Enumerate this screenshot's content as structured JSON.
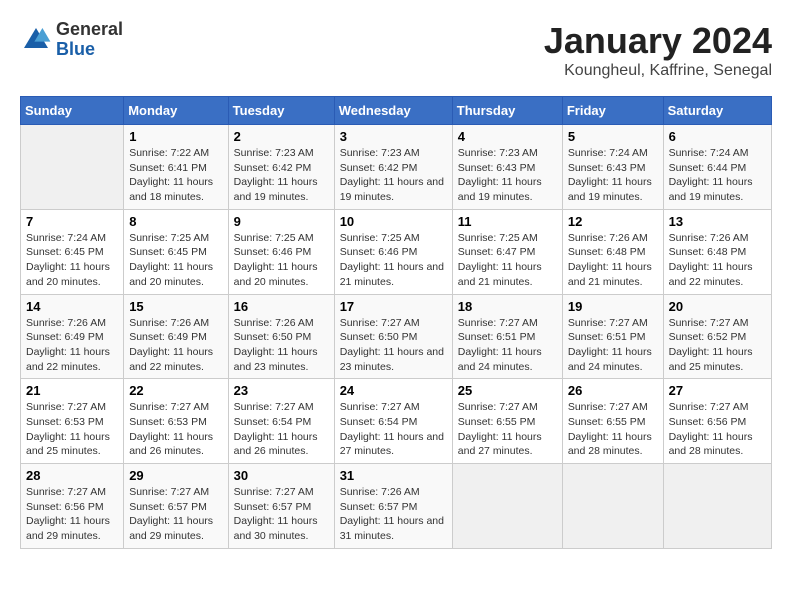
{
  "logo": {
    "general": "General",
    "blue": "Blue"
  },
  "title": "January 2024",
  "subtitle": "Koungheul, Kaffrine, Senegal",
  "days_header": [
    "Sunday",
    "Monday",
    "Tuesday",
    "Wednesday",
    "Thursday",
    "Friday",
    "Saturday"
  ],
  "weeks": [
    [
      {
        "num": "",
        "empty": true
      },
      {
        "num": "1",
        "sunrise": "Sunrise: 7:22 AM",
        "sunset": "Sunset: 6:41 PM",
        "daylight": "Daylight: 11 hours and 18 minutes."
      },
      {
        "num": "2",
        "sunrise": "Sunrise: 7:23 AM",
        "sunset": "Sunset: 6:42 PM",
        "daylight": "Daylight: 11 hours and 19 minutes."
      },
      {
        "num": "3",
        "sunrise": "Sunrise: 7:23 AM",
        "sunset": "Sunset: 6:42 PM",
        "daylight": "Daylight: 11 hours and 19 minutes."
      },
      {
        "num": "4",
        "sunrise": "Sunrise: 7:23 AM",
        "sunset": "Sunset: 6:43 PM",
        "daylight": "Daylight: 11 hours and 19 minutes."
      },
      {
        "num": "5",
        "sunrise": "Sunrise: 7:24 AM",
        "sunset": "Sunset: 6:43 PM",
        "daylight": "Daylight: 11 hours and 19 minutes."
      },
      {
        "num": "6",
        "sunrise": "Sunrise: 7:24 AM",
        "sunset": "Sunset: 6:44 PM",
        "daylight": "Daylight: 11 hours and 19 minutes."
      }
    ],
    [
      {
        "num": "7",
        "sunrise": "Sunrise: 7:24 AM",
        "sunset": "Sunset: 6:45 PM",
        "daylight": "Daylight: 11 hours and 20 minutes."
      },
      {
        "num": "8",
        "sunrise": "Sunrise: 7:25 AM",
        "sunset": "Sunset: 6:45 PM",
        "daylight": "Daylight: 11 hours and 20 minutes."
      },
      {
        "num": "9",
        "sunrise": "Sunrise: 7:25 AM",
        "sunset": "Sunset: 6:46 PM",
        "daylight": "Daylight: 11 hours and 20 minutes."
      },
      {
        "num": "10",
        "sunrise": "Sunrise: 7:25 AM",
        "sunset": "Sunset: 6:46 PM",
        "daylight": "Daylight: 11 hours and 21 minutes."
      },
      {
        "num": "11",
        "sunrise": "Sunrise: 7:25 AM",
        "sunset": "Sunset: 6:47 PM",
        "daylight": "Daylight: 11 hours and 21 minutes."
      },
      {
        "num": "12",
        "sunrise": "Sunrise: 7:26 AM",
        "sunset": "Sunset: 6:48 PM",
        "daylight": "Daylight: 11 hours and 21 minutes."
      },
      {
        "num": "13",
        "sunrise": "Sunrise: 7:26 AM",
        "sunset": "Sunset: 6:48 PM",
        "daylight": "Daylight: 11 hours and 22 minutes."
      }
    ],
    [
      {
        "num": "14",
        "sunrise": "Sunrise: 7:26 AM",
        "sunset": "Sunset: 6:49 PM",
        "daylight": "Daylight: 11 hours and 22 minutes."
      },
      {
        "num": "15",
        "sunrise": "Sunrise: 7:26 AM",
        "sunset": "Sunset: 6:49 PM",
        "daylight": "Daylight: 11 hours and 22 minutes."
      },
      {
        "num": "16",
        "sunrise": "Sunrise: 7:26 AM",
        "sunset": "Sunset: 6:50 PM",
        "daylight": "Daylight: 11 hours and 23 minutes."
      },
      {
        "num": "17",
        "sunrise": "Sunrise: 7:27 AM",
        "sunset": "Sunset: 6:50 PM",
        "daylight": "Daylight: 11 hours and 23 minutes."
      },
      {
        "num": "18",
        "sunrise": "Sunrise: 7:27 AM",
        "sunset": "Sunset: 6:51 PM",
        "daylight": "Daylight: 11 hours and 24 minutes."
      },
      {
        "num": "19",
        "sunrise": "Sunrise: 7:27 AM",
        "sunset": "Sunset: 6:51 PM",
        "daylight": "Daylight: 11 hours and 24 minutes."
      },
      {
        "num": "20",
        "sunrise": "Sunrise: 7:27 AM",
        "sunset": "Sunset: 6:52 PM",
        "daylight": "Daylight: 11 hours and 25 minutes."
      }
    ],
    [
      {
        "num": "21",
        "sunrise": "Sunrise: 7:27 AM",
        "sunset": "Sunset: 6:53 PM",
        "daylight": "Daylight: 11 hours and 25 minutes."
      },
      {
        "num": "22",
        "sunrise": "Sunrise: 7:27 AM",
        "sunset": "Sunset: 6:53 PM",
        "daylight": "Daylight: 11 hours and 26 minutes."
      },
      {
        "num": "23",
        "sunrise": "Sunrise: 7:27 AM",
        "sunset": "Sunset: 6:54 PM",
        "daylight": "Daylight: 11 hours and 26 minutes."
      },
      {
        "num": "24",
        "sunrise": "Sunrise: 7:27 AM",
        "sunset": "Sunset: 6:54 PM",
        "daylight": "Daylight: 11 hours and 27 minutes."
      },
      {
        "num": "25",
        "sunrise": "Sunrise: 7:27 AM",
        "sunset": "Sunset: 6:55 PM",
        "daylight": "Daylight: 11 hours and 27 minutes."
      },
      {
        "num": "26",
        "sunrise": "Sunrise: 7:27 AM",
        "sunset": "Sunset: 6:55 PM",
        "daylight": "Daylight: 11 hours and 28 minutes."
      },
      {
        "num": "27",
        "sunrise": "Sunrise: 7:27 AM",
        "sunset": "Sunset: 6:56 PM",
        "daylight": "Daylight: 11 hours and 28 minutes."
      }
    ],
    [
      {
        "num": "28",
        "sunrise": "Sunrise: 7:27 AM",
        "sunset": "Sunset: 6:56 PM",
        "daylight": "Daylight: 11 hours and 29 minutes."
      },
      {
        "num": "29",
        "sunrise": "Sunrise: 7:27 AM",
        "sunset": "Sunset: 6:57 PM",
        "daylight": "Daylight: 11 hours and 29 minutes."
      },
      {
        "num": "30",
        "sunrise": "Sunrise: 7:27 AM",
        "sunset": "Sunset: 6:57 PM",
        "daylight": "Daylight: 11 hours and 30 minutes."
      },
      {
        "num": "31",
        "sunrise": "Sunrise: 7:26 AM",
        "sunset": "Sunset: 6:57 PM",
        "daylight": "Daylight: 11 hours and 31 minutes."
      },
      {
        "num": "",
        "empty": true
      },
      {
        "num": "",
        "empty": true
      },
      {
        "num": "",
        "empty": true
      }
    ]
  ]
}
